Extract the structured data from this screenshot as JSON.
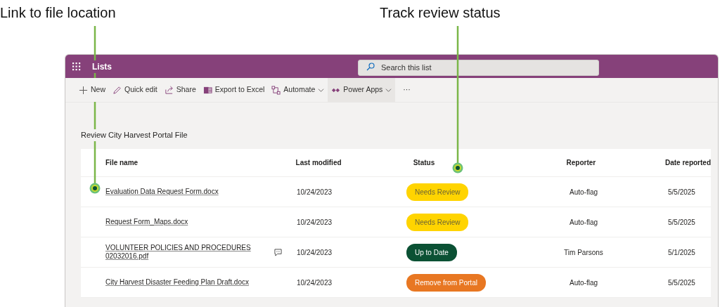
{
  "callouts": [
    {
      "text": "Link to file location"
    },
    {
      "text": "Track review status"
    }
  ],
  "app_bar": {
    "app_name": "Lists",
    "search": {
      "placeholder": "Search this list"
    }
  },
  "toolbar": [
    {
      "kind": "new",
      "label": "New",
      "dropdown": false,
      "selected": false
    },
    {
      "kind": "edit",
      "label": "Quick edit",
      "dropdown": false,
      "selected": false
    },
    {
      "kind": "share",
      "label": "Share",
      "dropdown": false,
      "selected": false
    },
    {
      "kind": "excel",
      "label": "Export to Excel",
      "dropdown": false,
      "selected": false
    },
    {
      "kind": "automate",
      "label": "Automate",
      "dropdown": true,
      "selected": false
    },
    {
      "kind": "powerapps",
      "label": "Power Apps",
      "dropdown": true,
      "selected": true
    },
    {
      "kind": "more",
      "label": "···",
      "dropdown": false,
      "selected": false
    }
  ],
  "list_title": "Review City Harvest Portal File",
  "table": {
    "columns": [
      "File name",
      "Last modified",
      "Status",
      "Reporter",
      "Date reported"
    ],
    "rows": [
      {
        "file_name": "Evaluation Data Request Form.docx",
        "comment": false,
        "last_modified": "10/24/2023",
        "status": {
          "label": "Needs Review",
          "color": "#ffd400"
        },
        "reporter": "Auto-flag",
        "date_reported": "5/5/2025"
      },
      {
        "file_name": "Request Form_Maps.docx",
        "comment": false,
        "last_modified": "10/24/2023",
        "status": {
          "label": "Needs Review",
          "color": "#ffd400"
        },
        "reporter": "Auto-flag",
        "date_reported": "5/5/2025"
      },
      {
        "file_name": "VOLUNTEER POLICIES AND PROCEDURES 02032016.pdf",
        "comment": true,
        "last_modified": "10/24/2023",
        "status": {
          "label": "Up to Date",
          "color": "#0b5134"
        },
        "reporter": "Tim Parsons",
        "date_reported": "5/1/2025"
      },
      {
        "file_name": "City Harvest Disaster Feeding Plan Draft.docx",
        "comment": false,
        "last_modified": "10/24/2023",
        "status": {
          "label": "Remove from Portal",
          "color": "#e87722"
        },
        "reporter": "Auto-flag",
        "date_reported": "5/5/2025"
      }
    ]
  }
}
